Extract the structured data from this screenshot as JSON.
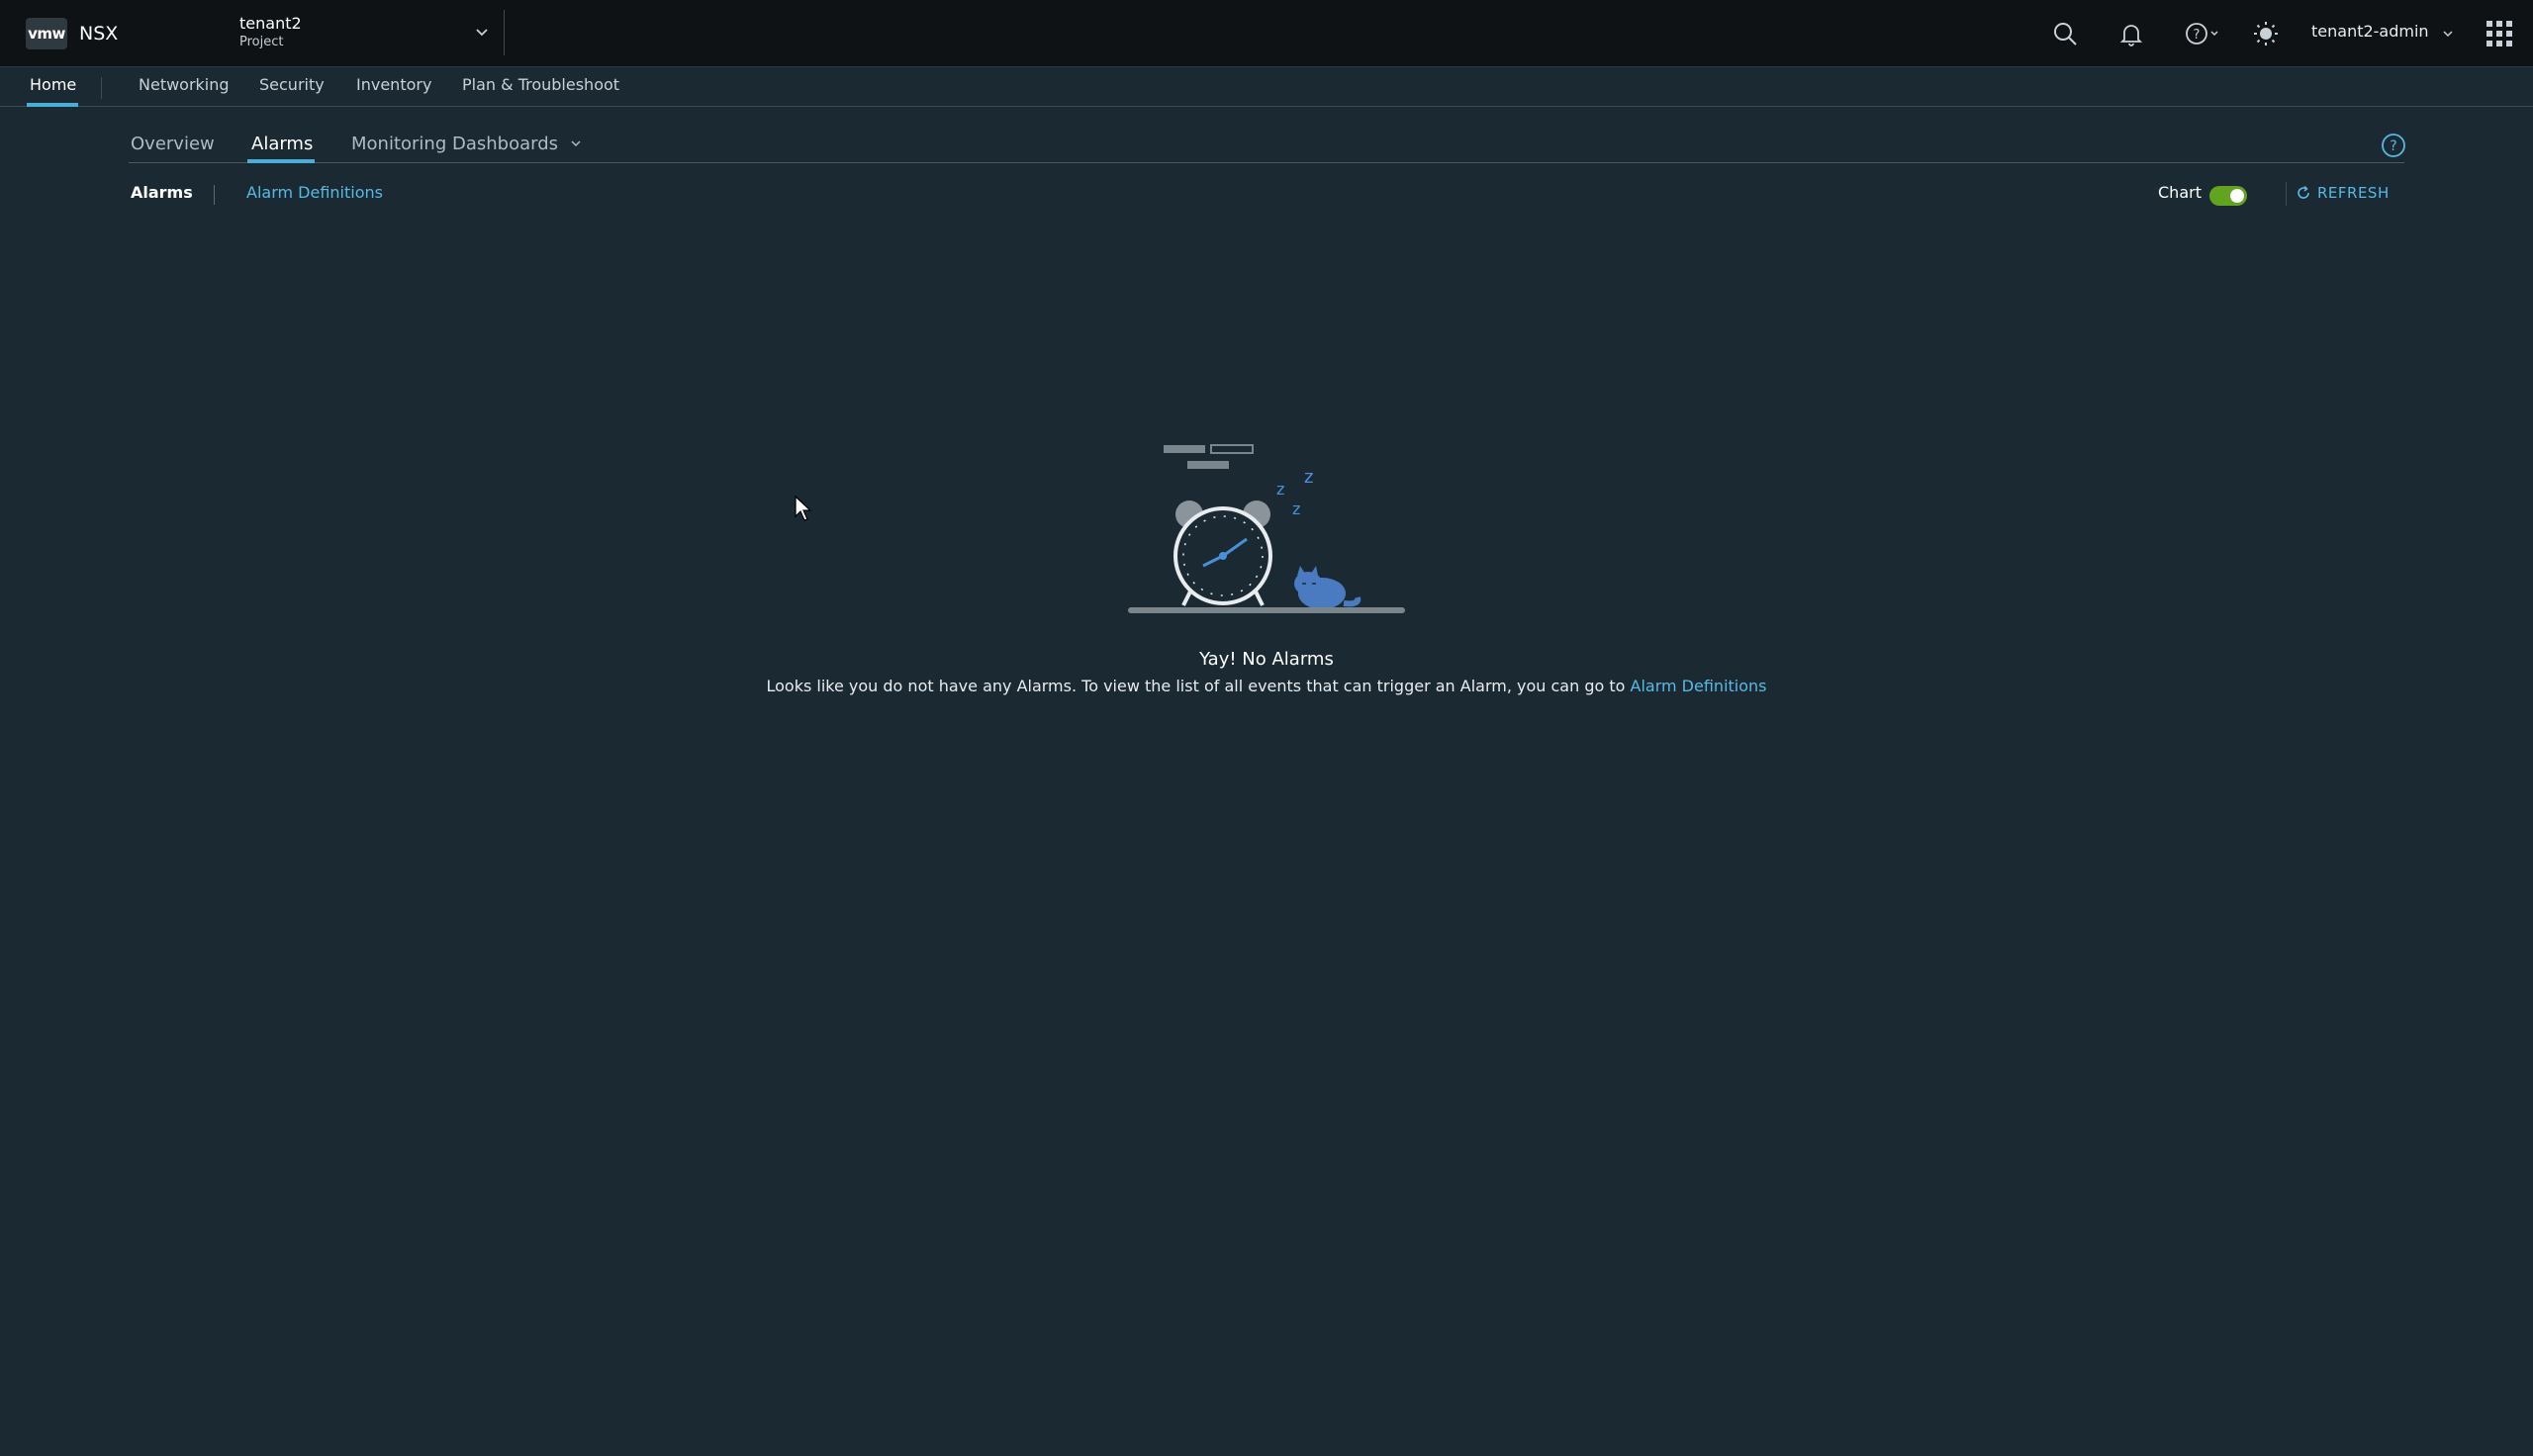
{
  "app": {
    "logo": "vmw",
    "product": "NSX"
  },
  "project": {
    "name": "tenant2",
    "type": "Project"
  },
  "header": {
    "user": "tenant2-admin"
  },
  "main_nav": [
    {
      "label": "Home"
    },
    {
      "label": "Networking"
    },
    {
      "label": "Security"
    },
    {
      "label": "Inventory"
    },
    {
      "label": "Plan & Troubleshoot"
    }
  ],
  "sub_tabs": [
    {
      "label": "Overview"
    },
    {
      "label": "Alarms"
    },
    {
      "label": "Monitoring Dashboards"
    }
  ],
  "secondary": {
    "alarms": "Alarms",
    "definitions": "Alarm Definitions"
  },
  "toolbar": {
    "chart_label": "Chart",
    "chart_enabled": true,
    "refresh_label": "REFRESH"
  },
  "empty_state": {
    "title": "Yay! No Alarms",
    "message": "Looks like you do not have any Alarms. To view the list of all events that can trigger an Alarm, you can go to ",
    "link": "Alarm Definitions"
  },
  "colors": {
    "accent": "#49afd9",
    "link": "#57b9e6",
    "toggle_on": "#62a420",
    "background": "#1b2a32",
    "header": "#0f1215"
  }
}
